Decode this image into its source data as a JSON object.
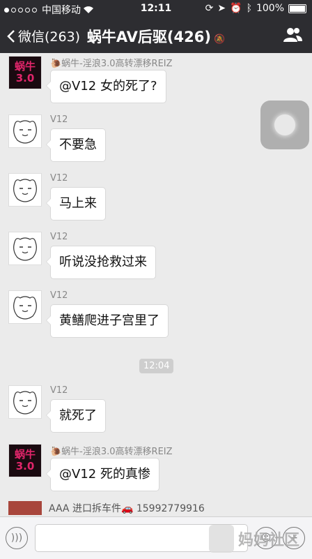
{
  "status_bar": {
    "carrier": "中国移动",
    "time": "12:11",
    "battery": "100%"
  },
  "nav": {
    "back_label": "微信(263)",
    "title": "蜗牛AV后驱(426)"
  },
  "messages": [
    {
      "sender": "🐌蜗牛-淫浪3.0高转漂移REIZ",
      "text": "@V12 女的死了?",
      "avatar": "snail",
      "avatar_text": "蜗牛\n3.0"
    },
    {
      "sender": "V12",
      "text": "不要急",
      "avatar": "cat"
    },
    {
      "sender": "V12",
      "text": "马上来",
      "avatar": "cat"
    },
    {
      "sender": "V12",
      "text": "听说没抢救过来",
      "avatar": "cat"
    },
    {
      "sender": "V12",
      "text": "黄鳝爬进子宫里了",
      "avatar": "cat"
    },
    {
      "sender": "V12",
      "text": "就死了",
      "avatar": "cat"
    },
    {
      "sender": "🐌蜗牛-淫浪3.0高转漂移REIZ",
      "text": "@V12  死的真惨",
      "avatar": "snail",
      "avatar_text": "蜗牛\n3.0"
    }
  ],
  "time_divider": "12:04",
  "bottom_preview": "AAA 进口拆车件🚗 15992779916",
  "watermark": "妈妈社区",
  "colors": {
    "navbar": "#2d2d31",
    "chat_bg": "#ebebeb"
  }
}
